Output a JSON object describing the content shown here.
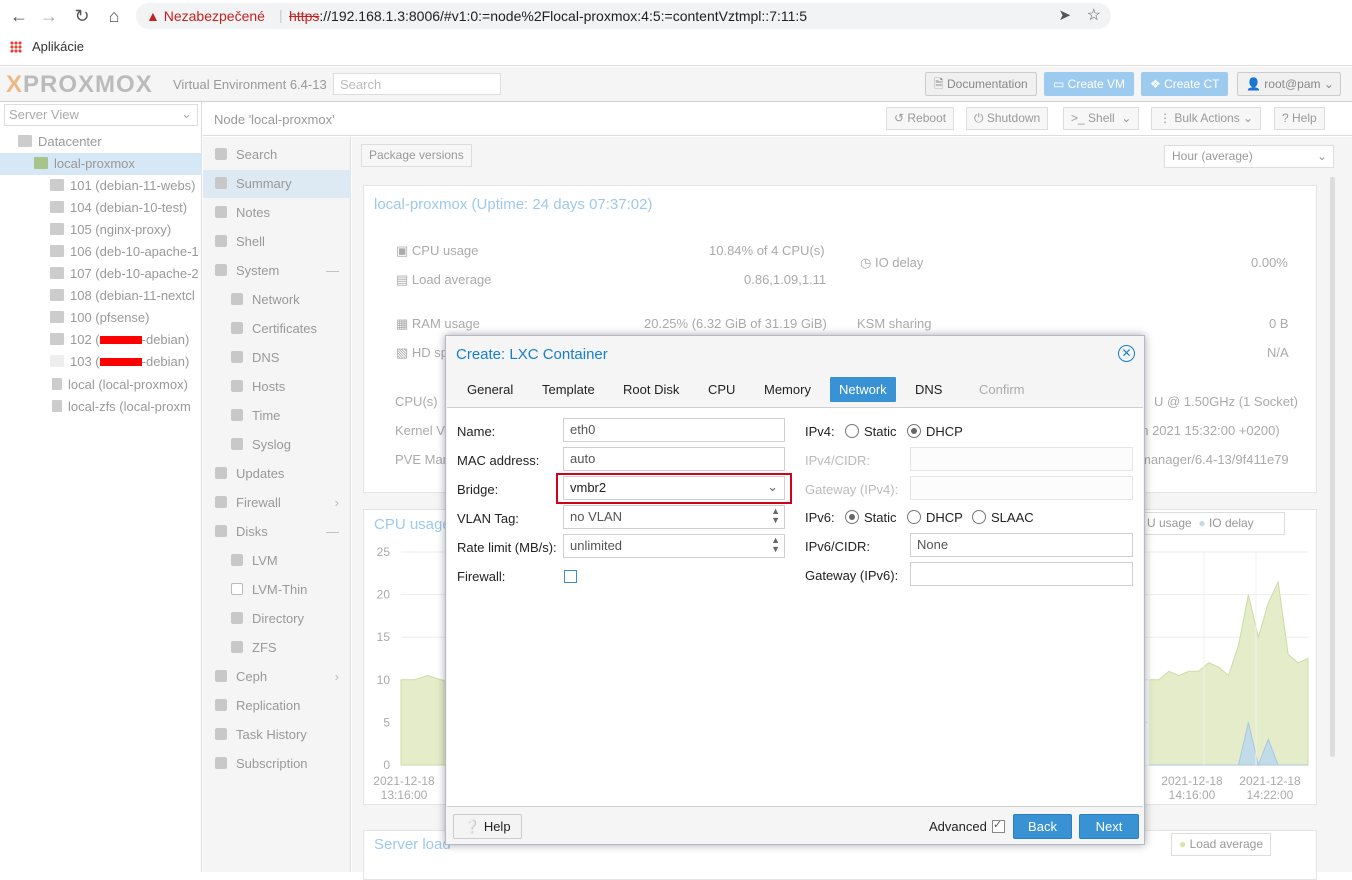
{
  "browser": {
    "warning": "Nezabezpečené",
    "url_scheme": "https",
    "url_rest": "://192.168.1.3:8006/#v1:0:=node%2Flocal-proxmox:4:5:=contentVztmpl::7:11:5",
    "bookmarks_label": "Aplikácie"
  },
  "header": {
    "logo": "PROXMOX",
    "version": "Virtual Environment 6.4-13",
    "search_placeholder": "Search",
    "documentation": "Documentation",
    "create_vm": "Create VM",
    "create_ct": "Create CT",
    "user": "root@pam"
  },
  "tree": {
    "view": "Server View",
    "items": [
      {
        "label": "Datacenter"
      },
      {
        "label": "local-proxmox"
      },
      {
        "label": "101 (debian-11-webs)"
      },
      {
        "label": "104 (debian-10-test)"
      },
      {
        "label": "105 (nginx-proxy)"
      },
      {
        "label": "106 (deb-10-apache-1"
      },
      {
        "label": "107 (deb-10-apache-2"
      },
      {
        "label": "108 (debian-11-nextcl"
      },
      {
        "label": "100 (pfsense)"
      },
      {
        "label_prefix": "102 (",
        "label_suffix": "-debian)"
      },
      {
        "label_prefix": "103 (",
        "label_suffix": "-debian)"
      },
      {
        "label": "local (local-proxmox)"
      },
      {
        "label": "local-zfs (local-proxm"
      }
    ]
  },
  "node": {
    "title": "Node 'local-proxmox'",
    "reboot": "Reboot",
    "shutdown": "Shutdown",
    "shell": "Shell",
    "bulk_actions": "Bulk Actions",
    "help": "Help"
  },
  "menu": [
    "Search",
    "Summary",
    "Notes",
    "Shell",
    "System",
    "Network",
    "Certificates",
    "DNS",
    "Hosts",
    "Time",
    "Syslog",
    "Updates",
    "Firewall",
    "Disks",
    "LVM",
    "LVM-Thin",
    "Directory",
    "ZFS",
    "Ceph",
    "Replication",
    "Task History",
    "Subscription"
  ],
  "summary": {
    "package_versions": "Package versions",
    "timeframe": "Hour (average)",
    "title": "local-proxmox (Uptime: 24 days 07:37:02)",
    "cpu_usage_label": "CPU usage",
    "cpu_usage_value": "10.84% of 4 CPU(s)",
    "load_label": "Load average",
    "load_value": "0.86,1.09,1.11",
    "io_label": "IO delay",
    "io_value": "0.00%",
    "ram_label": "RAM usage",
    "ram_value": "20.25% (6.32 GiB of 31.19 GiB)",
    "ksm_label": "KSM sharing",
    "ksm_value": "0 B",
    "hd_label": "HD sp",
    "hd_value": "N/A",
    "cpus_label": "CPU(s)",
    "cpus_value": "U @ 1.50GHz (1 Socket)",
    "kernel_label": "Kernel Ve",
    "kernel_value": "un 2021 15:32:00 +0200)",
    "pve_label": "PVE Man",
    "pve_value": "manager/6.4-13/9f411e79",
    "cpu_chart_title": "CPU usage",
    "legend_cpu": "U usage",
    "legend_io": "IO delay",
    "server_load_title": "Server load",
    "legend_load": "Load average"
  },
  "chart_data": {
    "type": "area",
    "ylim": [
      0,
      25
    ],
    "yticks": [
      "25",
      "20",
      "15",
      "10",
      "5",
      "0"
    ],
    "xticks": [
      {
        "date": "2021-12-18",
        "time": "13:16:00"
      },
      {
        "date": "2021-12-18",
        "time": "14:16:00"
      },
      {
        "date": "2021-12-18",
        "time": "14:22:00"
      }
    ],
    "series": [
      {
        "name": "CPU usage",
        "values_left": [
          10,
          10,
          10.5,
          10,
          9.5
        ],
        "values_right": [
          10,
          10,
          11,
          10.5,
          11,
          11,
          12,
          11.5,
          10.5,
          14,
          20,
          15,
          19,
          21.5,
          13,
          12,
          12.5
        ]
      },
      {
        "name": "IO delay",
        "values_right": [
          0,
          0,
          0,
          0,
          0,
          0,
          0,
          0,
          0,
          0,
          5,
          0,
          3,
          0,
          0,
          0,
          0
        ]
      }
    ],
    "colors": {
      "cpu": "#e4ecc9",
      "io": "#c2dbe9"
    }
  },
  "dialog": {
    "title": "Create: LXC Container",
    "tabs": [
      "General",
      "Template",
      "Root Disk",
      "CPU",
      "Memory",
      "Network",
      "DNS",
      "Confirm"
    ],
    "name_label": "Name:",
    "name_value": "eth0",
    "mac_label": "MAC address:",
    "mac_value": "auto",
    "bridge_label": "Bridge:",
    "bridge_value": "vmbr2",
    "vlan_label": "VLAN Tag:",
    "vlan_value": "no VLAN",
    "rate_label": "Rate limit (MB/s):",
    "rate_value": "unlimited",
    "firewall_label": "Firewall:",
    "ipv4_label": "IPv4:",
    "static": "Static",
    "dhcp": "DHCP",
    "slaac": "SLAAC",
    "ipv4cidr_label": "IPv4/CIDR:",
    "gw4_label": "Gateway (IPv4):",
    "ipv6_label": "IPv6:",
    "ipv6cidr_label": "IPv6/CIDR:",
    "ipv6cidr_value": "None",
    "gw6_label": "Gateway (IPv6):",
    "help": "Help",
    "advanced": "Advanced",
    "back": "Back",
    "next": "Next"
  }
}
